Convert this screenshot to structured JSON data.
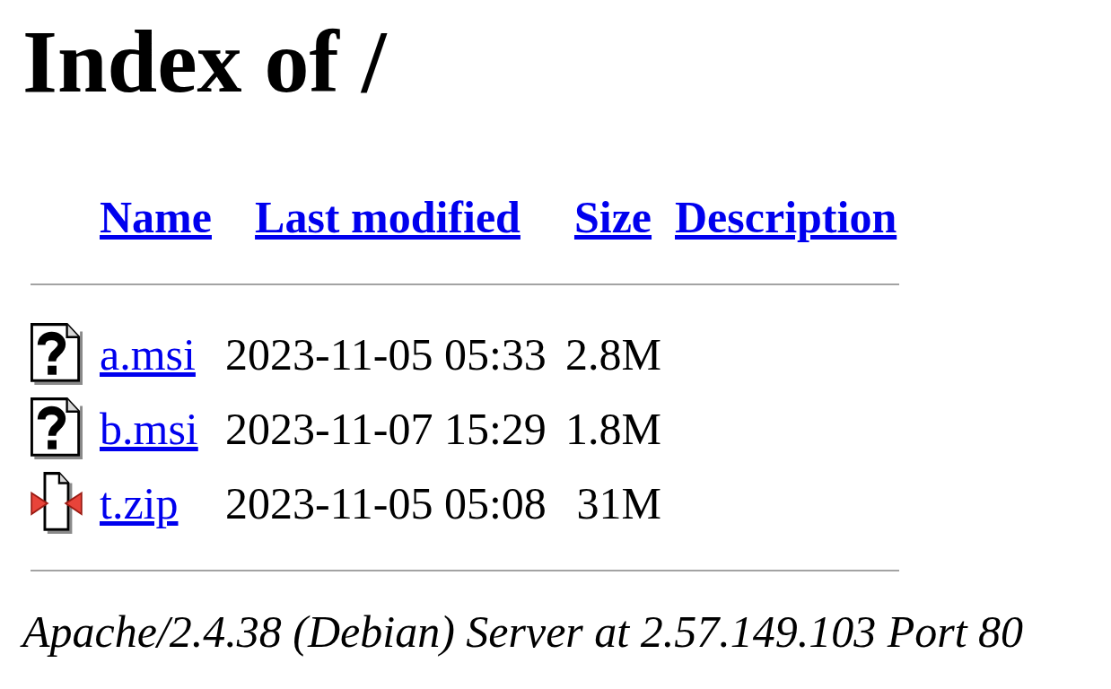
{
  "heading": "Index of /",
  "table": {
    "columns": [
      "Name",
      "Last modified",
      "Size",
      "Description"
    ],
    "rows": [
      {
        "kind": "unknown",
        "name": "a.msi",
        "last_modified": "2023-11-05 05:33",
        "size": "2.8M"
      },
      {
        "kind": "unknown",
        "name": "b.msi",
        "last_modified": "2023-11-07 15:29",
        "size": "1.8M"
      },
      {
        "kind": "compressed",
        "name": "t.zip",
        "last_modified": "2023-11-05 05:08",
        "size": "31M"
      }
    ]
  },
  "footer": "Apache/2.4.38 (Debian) Server at 2.57.149.103 Port 80"
}
